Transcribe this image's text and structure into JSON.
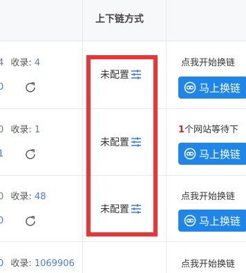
{
  "header": {
    "column_title": "上下链方式"
  },
  "rows": [
    {
      "left_digit": "4",
      "collect_label": "收录:",
      "collect_value": "4",
      "frag_digit": "0",
      "config": "未配置",
      "status": "点我开始换链",
      "button": "马上换链"
    },
    {
      "left_digit": "0",
      "collect_label": "收录:",
      "collect_value": "1",
      "frag_digit": "1",
      "config": "未配置",
      "status_num": "1",
      "status": "个网站等待下",
      "button": "马上换链"
    },
    {
      "left_digit": "0",
      "collect_label": "收录:",
      "collect_value": "48",
      "frag_digit": "0",
      "config": "未配置",
      "status": "点我开始换链",
      "button": "马上换链"
    },
    {
      "left_digit": "0",
      "collect_label": "收录:",
      "collect_value": "1069906",
      "status": "点我开始换链"
    }
  ],
  "colors": {
    "accent": "#1e86ea",
    "highlight": "#f23232",
    "link": "#4a7bd0"
  }
}
